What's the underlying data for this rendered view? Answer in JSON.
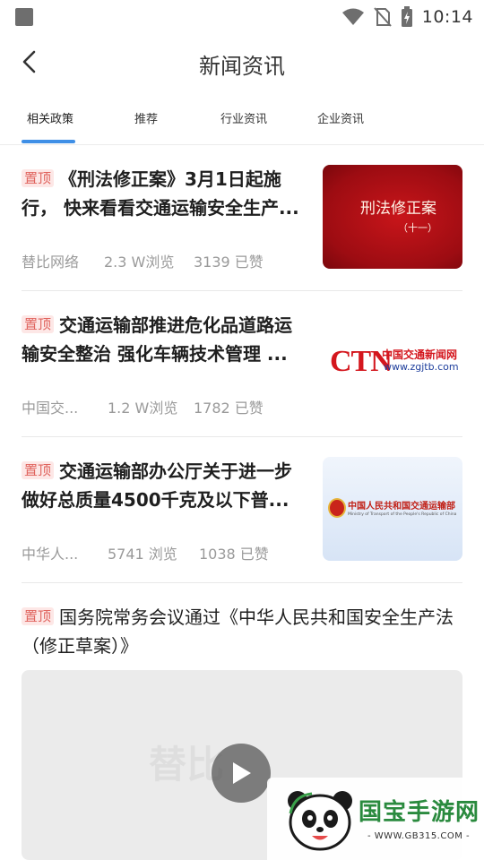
{
  "status_bar": {
    "time": "10:14",
    "icons": [
      "app-notification-icon",
      "wifi-icon",
      "no-sim-icon",
      "battery-charging-icon"
    ]
  },
  "header": {
    "title": "新闻资讯",
    "back_icon": "chevron-left-icon"
  },
  "tabs": [
    {
      "label": "相关政策",
      "active": true
    },
    {
      "label": "推荐",
      "active": false
    },
    {
      "label": "行业资讯",
      "active": false
    },
    {
      "label": "企业资讯",
      "active": false
    }
  ],
  "news": [
    {
      "badge": "置顶",
      "title": "《刑法修正案》3月1日起施行， 快来看看交通运输安全生产...",
      "source": "替比网络",
      "views": "2.3 W浏览",
      "likes": "3139 已赞",
      "thumb": {
        "line1": "刑法修正案",
        "line2": "（十一）"
      }
    },
    {
      "badge": "置顶",
      "title": "交通运输部推进危化品道路运输安全整治 强化车辆技术管理 ...",
      "source": "中国交...",
      "views": "1.2 W浏览",
      "likes": "1782 已赞",
      "thumb": {
        "logo_letters": "CTN",
        "site_name": "中国交通新闻网",
        "site_url": "www.zgjtb.com"
      }
    },
    {
      "badge": "置顶",
      "title": "交通运输部办公厅关于进一步做好总质量4500千克及以下普...",
      "source": "中华人...",
      "views": "5741 浏览",
      "likes": "1038 已赞",
      "thumb": {
        "org_cn": "中国人民共和国交通运输部",
        "org_en": "Ministry of Transport of the People's Republic of China"
      }
    },
    {
      "badge": "置顶",
      "title": "国务院常务会议通过《中华人民共和国安全生产法（修正草案）》",
      "video": {
        "watermark": "替比",
        "play_icon": "play-icon"
      }
    }
  ],
  "watermark_logo": {
    "title": "国宝手游网",
    "url": "- WWW.GB315.COM -"
  }
}
